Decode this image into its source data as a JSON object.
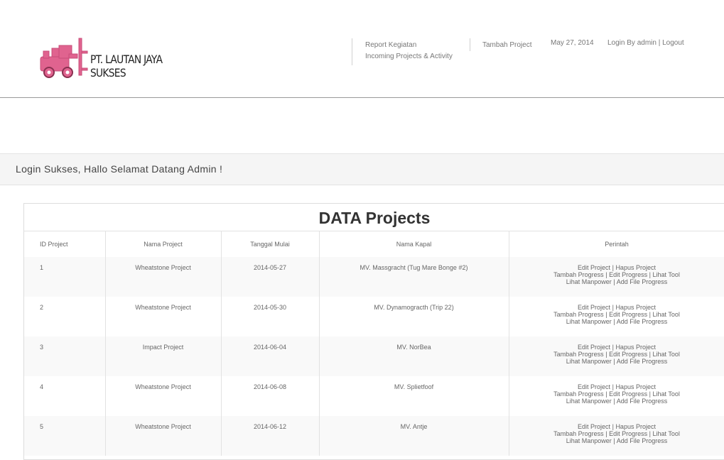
{
  "header": {
    "company_name": "PT. LAUTAN JAYA SUKSES",
    "nav": {
      "report_kegiatan": "Report Kegiatan",
      "incoming_projects": "Incoming Projects & Activity",
      "tambah_project": "Tambah Project",
      "date": "May 27, 2014",
      "login_by": "Login By admin",
      "separator": "|",
      "logout": "Logout"
    }
  },
  "alert": {
    "message": "Login Sukses, Hallo Selamat Datang Admin !"
  },
  "panel": {
    "title": "DATA Projects",
    "columns": [
      "ID Project",
      "Nama Project",
      "Tanggal Mulai",
      "Nama Kapal",
      "Perintah"
    ],
    "actions": {
      "edit_project": "Edit Project",
      "hapus_project": "Hapus Project",
      "tambah_progress": "Tambah Progress",
      "edit_progress": "Edit Progress",
      "lihat_tool": "Lihat Tool",
      "lihat_manpower": "Lihat Manpower",
      "add_file_progress": "Add File Progress",
      "sep": "|"
    },
    "rows": [
      {
        "id": "1",
        "nama": "Wheatstone Project",
        "tanggal": "2014-05-27",
        "kapal": "MV. Massgracht (Tug Mare Bonge #2)"
      },
      {
        "id": "2",
        "nama": "Wheatstone Project",
        "tanggal": "2014-05-30",
        "kapal": "MV. Dynamogracth (Trip 22)"
      },
      {
        "id": "3",
        "nama": "Impact Project",
        "tanggal": "2014-06-04",
        "kapal": "MV. NorBea"
      },
      {
        "id": "4",
        "nama": "Wheatstone Project",
        "tanggal": "2014-06-08",
        "kapal": "MV. Splietfoof"
      },
      {
        "id": "5",
        "nama": "Wheatstone Project",
        "tanggal": "2014-06-12",
        "kapal": "MV. Antje"
      }
    ]
  }
}
